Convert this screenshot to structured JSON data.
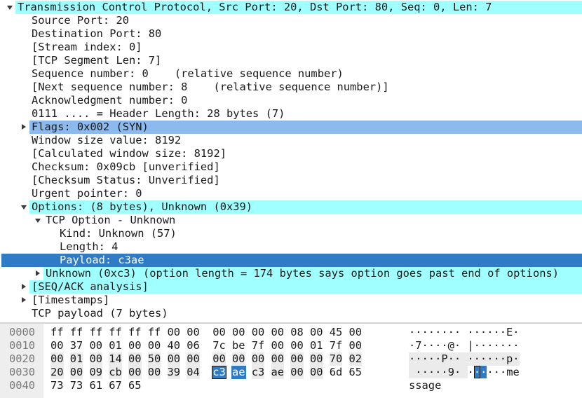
{
  "tree": {
    "rows": [
      {
        "text": "Transmission Control Protocol, Src Port: 20, Dst Port: 80, Seq: 0, Len: 7",
        "indent": 0,
        "arrow": "down",
        "hl": "cyan"
      },
      {
        "text": "Source Port: 20",
        "indent": 1,
        "arrow": "",
        "hl": ""
      },
      {
        "text": "Destination Port: 80",
        "indent": 1,
        "arrow": "",
        "hl": ""
      },
      {
        "text": "[Stream index: 0]",
        "indent": 1,
        "arrow": "",
        "hl": ""
      },
      {
        "text": "[TCP Segment Len: 7]",
        "indent": 1,
        "arrow": "",
        "hl": ""
      },
      {
        "text": "Sequence number: 0    (relative sequence number)",
        "indent": 1,
        "arrow": "",
        "hl": ""
      },
      {
        "text": "[Next sequence number: 8    (relative sequence number)]",
        "indent": 1,
        "arrow": "",
        "hl": ""
      },
      {
        "text": "Acknowledgment number: 0",
        "indent": 1,
        "arrow": "",
        "hl": ""
      },
      {
        "text": "0111 .... = Header Length: 28 bytes (7)",
        "indent": 1,
        "arrow": "",
        "hl": ""
      },
      {
        "text": "Flags: 0x002 (SYN)",
        "indent": 1,
        "arrow": "right",
        "hl": "blue"
      },
      {
        "text": "Window size value: 8192",
        "indent": 1,
        "arrow": "",
        "hl": ""
      },
      {
        "text": "[Calculated window size: 8192]",
        "indent": 1,
        "arrow": "",
        "hl": ""
      },
      {
        "text": "Checksum: 0x09cb [unverified]",
        "indent": 1,
        "arrow": "",
        "hl": ""
      },
      {
        "text": "[Checksum Status: Unverified]",
        "indent": 1,
        "arrow": "",
        "hl": ""
      },
      {
        "text": "Urgent pointer: 0",
        "indent": 1,
        "arrow": "",
        "hl": ""
      },
      {
        "text": "Options: (8 bytes), Unknown (0x39)",
        "indent": 1,
        "arrow": "down",
        "hl": "cyan"
      },
      {
        "text": "TCP Option - Unknown",
        "indent": 2,
        "arrow": "down",
        "hl": ""
      },
      {
        "text": "Kind: Unknown (57)",
        "indent": 3,
        "arrow": "",
        "hl": ""
      },
      {
        "text": "Length: 4",
        "indent": 3,
        "arrow": "",
        "hl": ""
      },
      {
        "text": "Payload: c3ae",
        "indent": 3,
        "arrow": "",
        "hl": "sel"
      },
      {
        "text": "Unknown (0xc3) (option length = 174 bytes says option goes past end of options)",
        "indent": 2,
        "arrow": "right",
        "hl": "cyan"
      },
      {
        "text": "[SEQ/ACK analysis]",
        "indent": 1,
        "arrow": "right",
        "hl": "cyan"
      },
      {
        "text": "[Timestamps]",
        "indent": 1,
        "arrow": "right",
        "hl": ""
      },
      {
        "text": "TCP payload (7 bytes)",
        "indent": 1,
        "arrow": "",
        "hl": ""
      }
    ]
  },
  "hex": {
    "lines": [
      {
        "offset": "0000",
        "bytes": [
          "ff",
          "ff",
          "ff",
          "ff",
          "ff",
          "ff",
          "00",
          "00",
          "00",
          "00",
          "00",
          "00",
          "08",
          "00",
          "45",
          "00"
        ],
        "ascii": "········ ······E·"
      },
      {
        "offset": "0010",
        "bytes": [
          "00",
          "37",
          "00",
          "01",
          "00",
          "00",
          "40",
          "06",
          "7c",
          "be",
          "7f",
          "00",
          "00",
          "01",
          "7f",
          "00"
        ],
        "ascii": "·7····@· |·······"
      },
      {
        "offset": "0020",
        "bytes": [
          "00",
          "01",
          "00",
          "14",
          "00",
          "50",
          "00",
          "00",
          "00",
          "00",
          "00",
          "00",
          "00",
          "00",
          "70",
          "02"
        ],
        "ascii": "·····P·· ······p·"
      },
      {
        "offset": "0030",
        "bytes": [
          "20",
          "00",
          "09",
          "cb",
          "00",
          "00",
          "39",
          "04",
          "c3",
          "ae",
          "c3",
          "ae",
          "00",
          "00",
          "6d",
          "65"
        ],
        "ascii": " ·····9· ······me"
      },
      {
        "offset": "0040",
        "bytes": [
          "73",
          "73",
          "61",
          "67",
          "65"
        ],
        "ascii": "ssage"
      }
    ],
    "selected_bytes": [
      56,
      57
    ]
  },
  "colors": {
    "cyan_highlight": "#a0ffff",
    "blue_highlight": "#8cb9ee",
    "selection": "#2f7bc4",
    "offset_text": "#7a7a7a"
  }
}
